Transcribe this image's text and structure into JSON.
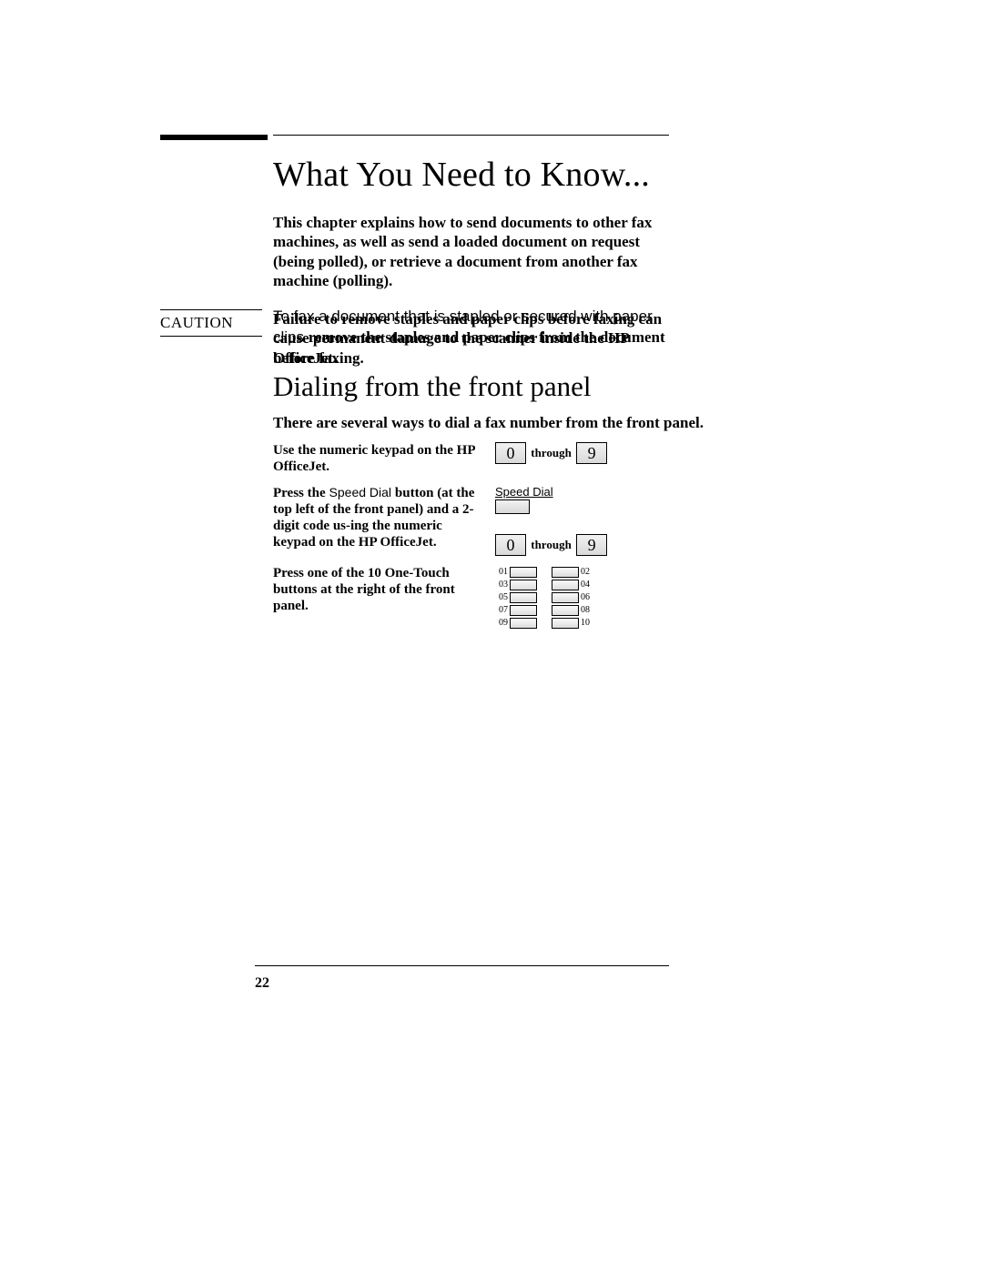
{
  "header": {
    "title": "What You Need to Know..."
  },
  "intro": "This chapter explains how to send documents to other fax machines, as well as send a loaded document on request (being polled), or retrieve a document from another fax machine (polling).",
  "mixed": {
    "sans_part": "To fax a document that is stapled or secured with paper clips ",
    "bold_part": "remove the staples and paper clips from the document before faxing."
  },
  "caution": {
    "label": "CAUTION",
    "text": "Failure to remove staples and paper clips before faxing can cause permanent damage to the scanner inside the HP OfficeJet."
  },
  "subheading": "Dialing from the front panel",
  "dial_intro": "There are several ways to dial a fax number from the front panel.",
  "rows": {
    "r1_left": "Use the numeric keypad on the HP OfficeJet.",
    "key_zero": "0",
    "through": "through",
    "key_nine": "9",
    "r2_left_a": "Press the",
    "r2_left_b": " Speed Dial ",
    "r2_left_c": "button (at the top left of the front panel) and a 2-digit code us-ing the numeric keypad on the HP OfficeJet.",
    "speed_dial_caption": "Speed Dial",
    "r3_left": "Press one of the 10 One-Touch buttons at the right of the front panel.",
    "ot": {
      "n01": "01",
      "n02": "02",
      "n03": "03",
      "n04": "04",
      "n05": "05",
      "n06": "06",
      "n07": "07",
      "n08": "08",
      "n09": "09",
      "n10": "10"
    }
  },
  "footer": {
    "page_number": "22"
  }
}
